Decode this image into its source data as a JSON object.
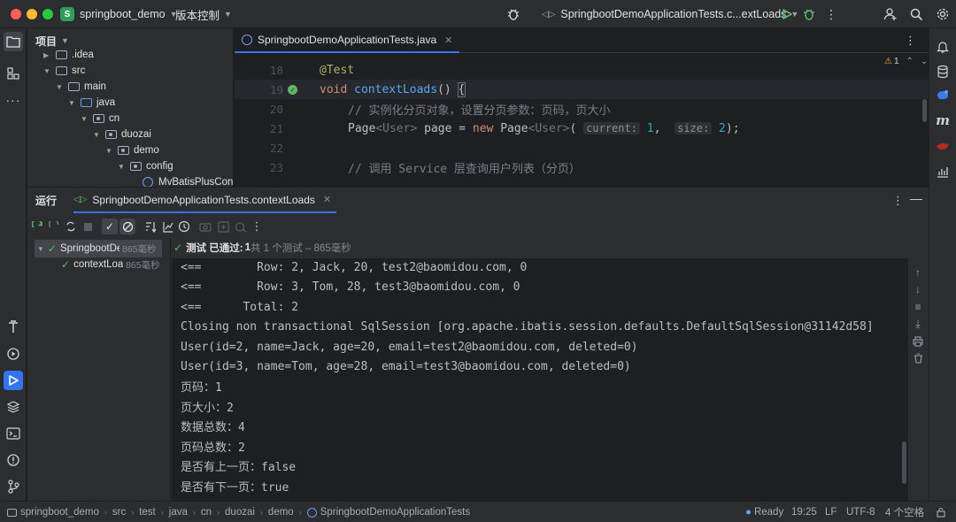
{
  "titlebar": {
    "project_badge": "S",
    "project_name": "springboot_demo",
    "vcs_label": "版本控制",
    "run_config": "SpringbootDemoApplicationTests.c...extLoads"
  },
  "project_pane": {
    "title": "项目",
    "tree": [
      {
        "label": ".idea",
        "depth": 1,
        "expanded": false
      },
      {
        "label": "src",
        "depth": 1,
        "expanded": true
      },
      {
        "label": "main",
        "depth": 2,
        "expanded": true
      },
      {
        "label": "java",
        "depth": 3,
        "expanded": true
      },
      {
        "label": "cn",
        "depth": 4,
        "expanded": true
      },
      {
        "label": "duozai",
        "depth": 5,
        "expanded": true
      },
      {
        "label": "demo",
        "depth": 6,
        "expanded": true
      },
      {
        "label": "config",
        "depth": 7,
        "expanded": true
      },
      {
        "label": "MvBatisPlusConfi",
        "depth": 8,
        "expanded": false
      }
    ]
  },
  "editor": {
    "tab_label": "SpringbootDemoApplicationTests.java",
    "warning_count": "1",
    "lines": [
      {
        "num": "18",
        "text": "@Test"
      },
      {
        "num": "19",
        "text": "void contextLoads() {"
      },
      {
        "num": "20",
        "text": "// 实例化分页对象，设置分页参数：页码，页大小"
      },
      {
        "num": "21",
        "text": "Page<User> page = new Page<User>(current: 1,  size: 2);"
      },
      {
        "num": "22",
        "text": ""
      },
      {
        "num": "23",
        "text": "// 调用 Service 层查询用户列表（分页）"
      }
    ],
    "hint_current": "current:",
    "hint_size": "size:"
  },
  "run_panel": {
    "title": "运行",
    "tab_label": "SpringbootDemoApplicationTests.contextLoads",
    "tree": [
      {
        "label": "SpringbootDem",
        "duration": "865毫秒"
      },
      {
        "label": "contextLoac",
        "duration": "865毫秒"
      }
    ],
    "status_prefix": "测试 已通过:",
    "status_count": "1",
    "status_detail": "共 1 个测试 – 865毫秒",
    "console": [
      "<==        Row: 2, Jack, 20, test2@baomidou.com, 0",
      "<==        Row: 3, Tom, 28, test3@baomidou.com, 0",
      "<==      Total: 2",
      "Closing non transactional SqlSession [org.apache.ibatis.session.defaults.DefaultSqlSession@31142d58]",
      "User(id=2, name=Jack, age=20, email=test2@baomidou.com, deleted=0)",
      "User(id=3, name=Tom, age=28, email=test3@baomidou.com, deleted=0)",
      "页码：1",
      "页大小：2",
      "数据总数：4",
      "页码总数：2",
      "是否有上一页：false",
      "是否有下一页：true"
    ]
  },
  "statusbar": {
    "breadcrumb": [
      "springboot_demo",
      "src",
      "test",
      "java",
      "cn",
      "duozai",
      "demo",
      "SpringbootDemoApplicationTests"
    ],
    "ready": "Ready",
    "position": "19:25",
    "line_sep": "LF",
    "encoding": "UTF-8",
    "indent": "4 个空格"
  },
  "colors": {
    "accent": "#3574f0",
    "pass_green": "#5fb865",
    "project_badge": "#2f9e59"
  }
}
